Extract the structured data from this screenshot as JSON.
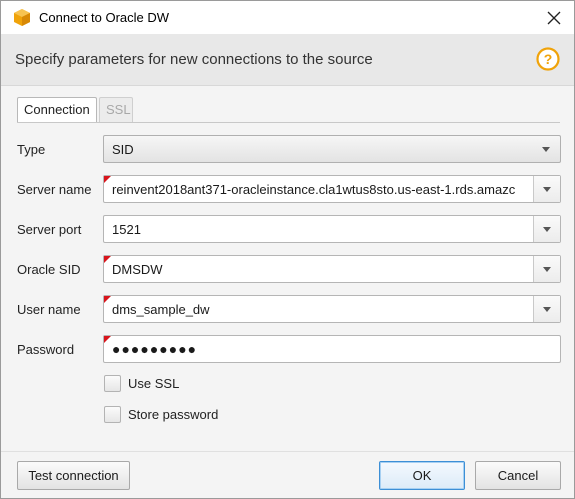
{
  "window": {
    "title": "Connect to Oracle DW",
    "icon": "aws-cube-icon",
    "accent": "#f0a30a"
  },
  "header": {
    "text": "Specify parameters for new connections to the source",
    "help_icon": "help-icon"
  },
  "tabs": [
    {
      "label": "Connection",
      "active": true
    },
    {
      "label": "SSL",
      "active": false,
      "disabled": true
    }
  ],
  "form": {
    "type": {
      "label": "Type",
      "value": "SID"
    },
    "server_name": {
      "label": "Server name",
      "value": "reinvent2018ant371-oracleinstance.cla1wtus8sto.us-east-1.rds.amazc"
    },
    "server_port": {
      "label": "Server port",
      "value": "1521"
    },
    "oracle_sid": {
      "label": "Oracle SID",
      "value": "DMSDW"
    },
    "user_name": {
      "label": "User name",
      "value": "dms_sample_dw"
    },
    "password": {
      "label": "Password",
      "value": "●●●●●●●●●"
    }
  },
  "options": {
    "use_ssl": {
      "label": "Use SSL",
      "checked": false
    },
    "store_password": {
      "label": "Store password",
      "checked": false
    }
  },
  "buttons": {
    "test": "Test connection",
    "ok": "OK",
    "cancel": "Cancel"
  },
  "colors": {
    "required_marker": "#d8141b",
    "ok_border": "#3c8fd6"
  }
}
